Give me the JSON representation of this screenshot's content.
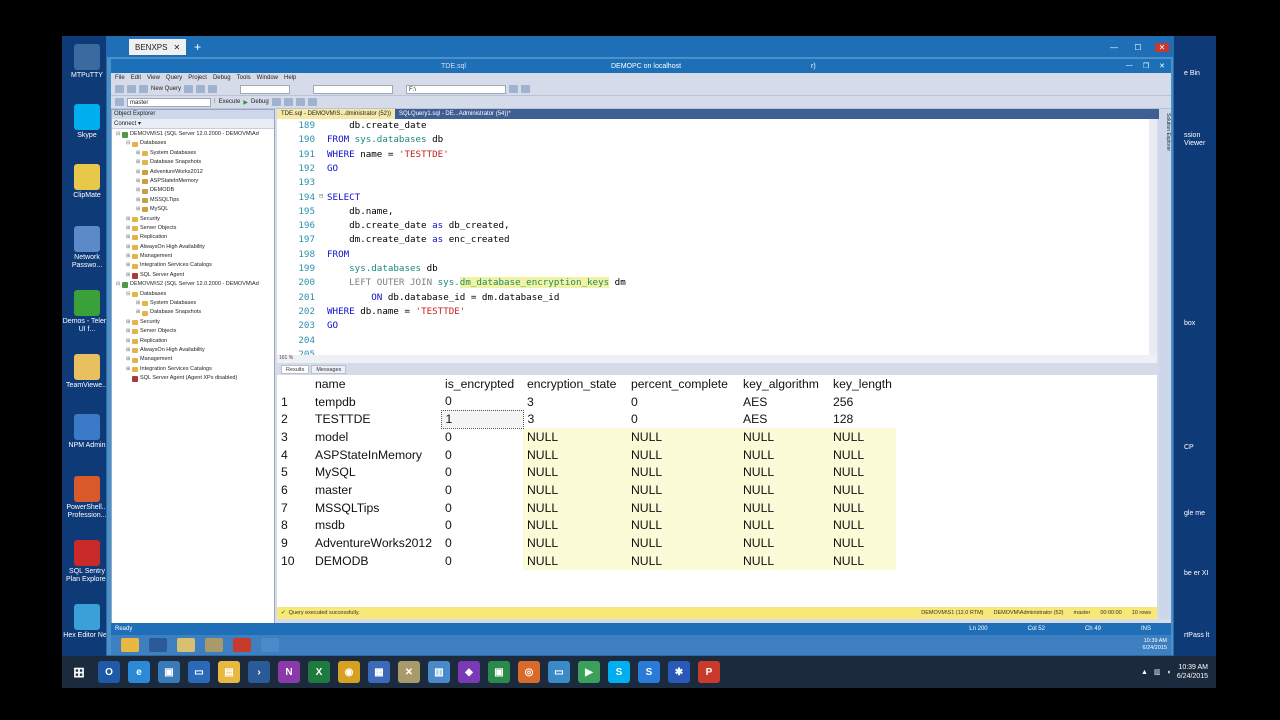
{
  "desktop": {
    "left_icons": [
      {
        "label": "MTPuTTY",
        "icon": "putty-icon",
        "color": "#3a6aa0"
      },
      {
        "label": "Skype",
        "icon": "skype-icon",
        "color": "#00aff0"
      },
      {
        "label": "ClipMate",
        "icon": "clipmate-icon",
        "color": "#e8c84a"
      },
      {
        "label": "Network Passwo...",
        "icon": "network-password-icon",
        "color": "#5a8ac8"
      },
      {
        "label": "Demos - Telerik UI f...",
        "icon": "mvc-icon",
        "color": "#3aa03a"
      },
      {
        "label": "TeamViewe...",
        "icon": "folder-icon",
        "color": "#e8c060"
      },
      {
        "label": "NPM Admin",
        "icon": "npm-admin-icon",
        "color": "#3a7ac8"
      },
      {
        "label": "PowerShell... Profession...",
        "icon": "powershell-icon",
        "color": "#d85a2a"
      },
      {
        "label": "SQL Sentry Plan Explorer",
        "icon": "sql-sentry-icon",
        "color": "#c82a2a"
      },
      {
        "label": "Hex Editor Neo",
        "icon": "hex-editor-icon",
        "color": "#3aa0d8"
      }
    ],
    "right_labels": [
      "e Bin",
      "ssion Viewer",
      "box",
      "CP",
      "gle me",
      "be er XI",
      "rtPass lt"
    ]
  },
  "rdp": {
    "tab_label": "BENXPS",
    "tab_close": "✕",
    "add_tab": "+"
  },
  "ssms": {
    "title": "DEMOPC on localhost",
    "title_file": "TDE.sql",
    "title_suffix": "r)",
    "menu": [
      "File",
      "Edit",
      "View",
      "Query",
      "Project",
      "Debug",
      "Tools",
      "Window",
      "Help"
    ],
    "toolbar": {
      "new_query": "New Query",
      "database": "master",
      "execute": "Execute",
      "debug": "Debug",
      "path": "F:\\"
    },
    "object_explorer": {
      "title": "Object Explorer",
      "connect": "Connect ▾",
      "nodes": [
        {
          "level": 0,
          "toggle": "⊟",
          "type": "server",
          "label": "DEMOVM\\S1 (SQL Server 12.0.2000 - DEMOVM\\Ad"
        },
        {
          "level": 1,
          "toggle": "⊟",
          "type": "folder",
          "label": "Databases"
        },
        {
          "level": 2,
          "toggle": "⊞",
          "type": "folder",
          "label": "System Databases"
        },
        {
          "level": 2,
          "toggle": "⊞",
          "type": "folder",
          "label": "Database Snapshots"
        },
        {
          "level": 2,
          "toggle": "⊞",
          "type": "db",
          "label": "AdventureWorks2012"
        },
        {
          "level": 2,
          "toggle": "⊞",
          "type": "db",
          "label": "ASPStateInMemory"
        },
        {
          "level": 2,
          "toggle": "⊞",
          "type": "db",
          "label": "DEMODB"
        },
        {
          "level": 2,
          "toggle": "⊞",
          "type": "db",
          "label": "MSSQLTips"
        },
        {
          "level": 2,
          "toggle": "⊞",
          "type": "db",
          "label": "MySQL"
        },
        {
          "level": 1,
          "toggle": "⊞",
          "type": "folder",
          "label": "Security"
        },
        {
          "level": 1,
          "toggle": "⊞",
          "type": "folder",
          "label": "Server Objects"
        },
        {
          "level": 1,
          "toggle": "⊞",
          "type": "folder",
          "label": "Replication"
        },
        {
          "level": 1,
          "toggle": "⊞",
          "type": "folder",
          "label": "AlwaysOn High Availability"
        },
        {
          "level": 1,
          "toggle": "⊞",
          "type": "folder",
          "label": "Management"
        },
        {
          "level": 1,
          "toggle": "⊞",
          "type": "folder",
          "label": "Integration Services Catalogs"
        },
        {
          "level": 1,
          "toggle": "⊞",
          "type": "agent",
          "label": "SQL Server Agent"
        },
        {
          "level": 0,
          "toggle": "⊟",
          "type": "server",
          "label": "DEMOVM\\S2 (SQL Server 12.0.2000 - DEMOVM\\Ad"
        },
        {
          "level": 1,
          "toggle": "⊟",
          "type": "folder",
          "label": "Databases"
        },
        {
          "level": 2,
          "toggle": "⊞",
          "type": "folder",
          "label": "System Databases"
        },
        {
          "level": 2,
          "toggle": "⊞",
          "type": "folder",
          "label": "Database Snapshots"
        },
        {
          "level": 1,
          "toggle": "⊞",
          "type": "folder",
          "label": "Security"
        },
        {
          "level": 1,
          "toggle": "⊞",
          "type": "folder",
          "label": "Server Objects"
        },
        {
          "level": 1,
          "toggle": "⊞",
          "type": "folder",
          "label": "Replication"
        },
        {
          "level": 1,
          "toggle": "⊞",
          "type": "folder",
          "label": "AlwaysOn High Availability"
        },
        {
          "level": 1,
          "toggle": "⊞",
          "type": "folder",
          "label": "Management"
        },
        {
          "level": 1,
          "toggle": "⊞",
          "type": "folder",
          "label": "Integration Services Catalogs"
        },
        {
          "level": 1,
          "toggle": "",
          "type": "agent",
          "label": "SQL Server Agent (Agent XPs disabled)"
        }
      ]
    },
    "editor_tabs": [
      {
        "label": "TDE.sql - DEMOVM\\S...dministrator (52))",
        "active": true
      },
      {
        "label": "SQLQuery1.sql - DE...Administrator (54))*",
        "active": false
      }
    ],
    "code_lines": [
      {
        "n": "189",
        "segs": [
          [
            "",
            "    db.create_date"
          ]
        ]
      },
      {
        "n": "190",
        "segs": [
          [
            "kw",
            "FROM "
          ],
          [
            "teal",
            "sys.databases"
          ],
          [
            "",
            " db"
          ]
        ]
      },
      {
        "n": "191",
        "segs": [
          [
            "kw",
            "WHERE "
          ],
          [
            "",
            "name = "
          ],
          [
            "str",
            "'TESTTDE'"
          ]
        ]
      },
      {
        "n": "192",
        "segs": [
          [
            "kw",
            "GO"
          ]
        ]
      },
      {
        "n": "193",
        "segs": [
          [
            "",
            ""
          ]
        ]
      },
      {
        "n": "194",
        "fold": "⊟",
        "segs": [
          [
            "kw",
            "SELECT"
          ]
        ]
      },
      {
        "n": "195",
        "segs": [
          [
            "",
            "    db.name,"
          ]
        ]
      },
      {
        "n": "196",
        "segs": [
          [
            "",
            "    db.create_date "
          ],
          [
            "kw",
            "as"
          ],
          [
            "",
            " db_created,"
          ]
        ]
      },
      {
        "n": "197",
        "segs": [
          [
            "",
            "    dm.create_date "
          ],
          [
            "kw",
            "as"
          ],
          [
            "",
            " enc_created"
          ]
        ]
      },
      {
        "n": "198",
        "segs": [
          [
            "kw",
            "FROM"
          ]
        ]
      },
      {
        "n": "199",
        "segs": [
          [
            "",
            "    "
          ],
          [
            "teal",
            "sys.databases"
          ],
          [
            "",
            " db"
          ]
        ]
      },
      {
        "n": "200",
        "segs": [
          [
            "gray",
            "    LEFT OUTER JOIN "
          ],
          [
            "teal",
            "sys."
          ],
          [
            "hl",
            "dm_database_encryption_keys"
          ],
          [
            "",
            " dm"
          ]
        ]
      },
      {
        "n": "201",
        "segs": [
          [
            "",
            "        "
          ],
          [
            "kw",
            "ON"
          ],
          [
            "",
            " db.database_id = dm.database_id"
          ]
        ]
      },
      {
        "n": "202",
        "segs": [
          [
            "kw",
            "WHERE "
          ],
          [
            "",
            "db.name = "
          ],
          [
            "str",
            "'TESTTDE'"
          ]
        ]
      },
      {
        "n": "203",
        "segs": [
          [
            "kw",
            "GO"
          ]
        ]
      },
      {
        "n": "204",
        "segs": [
          [
            "",
            ""
          ]
        ]
      },
      {
        "n": "205",
        "segs": [
          [
            "",
            ""
          ]
        ]
      }
    ],
    "zoom": "161 %",
    "result_tabs": [
      "Results",
      "Messages"
    ],
    "results": {
      "columns": [
        "name",
        "is_encrypted",
        "encryption_state",
        "percent_complete",
        "key_algorithm",
        "key_length"
      ],
      "rows": [
        [
          "1",
          "tempdb",
          "0",
          "3",
          "0",
          "AES",
          "256"
        ],
        [
          "2",
          "TESTTDE",
          "1",
          "3",
          "0",
          "AES",
          "128"
        ],
        [
          "3",
          "model",
          "0",
          "NULL",
          "NULL",
          "NULL",
          "NULL"
        ],
        [
          "4",
          "ASPStateInMemory",
          "0",
          "NULL",
          "NULL",
          "NULL",
          "NULL"
        ],
        [
          "5",
          "MySQL",
          "0",
          "NULL",
          "NULL",
          "NULL",
          "NULL"
        ],
        [
          "6",
          "master",
          "0",
          "NULL",
          "NULL",
          "NULL",
          "NULL"
        ],
        [
          "7",
          "MSSQLTips",
          "0",
          "NULL",
          "NULL",
          "NULL",
          "NULL"
        ],
        [
          "8",
          "msdb",
          "0",
          "NULL",
          "NULL",
          "NULL",
          "NULL"
        ],
        [
          "9",
          "AdventureWorks2012",
          "0",
          "NULL",
          "NULL",
          "NULL",
          "NULL"
        ],
        [
          "10",
          "DEMODB",
          "0",
          "NULL",
          "NULL",
          "NULL",
          "NULL"
        ]
      ]
    },
    "query_status": {
      "message": "Query executed successfully.",
      "server": "DEMOVM\\S1 (12.0 RTM)",
      "user": "DEMOVM\\Administrator (52)",
      "db": "master",
      "time": "00:00:00",
      "rows": "10 rows"
    },
    "statusbar": {
      "ready": "Ready",
      "ln": "Ln 200",
      "col": "Col 52",
      "ch": "Ch 49",
      "ins": "INS"
    },
    "solution_explorer": "Solution Explorer",
    "inner_clock": {
      "time": "10:39 AM",
      "date": "6/24/2015"
    }
  },
  "taskbar": {
    "apps": [
      {
        "icon": "outlook-icon",
        "glyph": "O",
        "color": "#1e5aa8"
      },
      {
        "icon": "ie-icon",
        "glyph": "e",
        "color": "#2a8ad8"
      },
      {
        "icon": "rdp-icon",
        "glyph": "▣",
        "color": "#3a7ab8"
      },
      {
        "icon": "monitor-icon",
        "glyph": "▭",
        "color": "#2a6ab8"
      },
      {
        "icon": "explorer-icon",
        "glyph": "▤",
        "color": "#e8b840"
      },
      {
        "icon": "powershell-icon",
        "glyph": "›",
        "color": "#2a5a98"
      },
      {
        "icon": "onenote-icon",
        "glyph": "N",
        "color": "#8a3aa8"
      },
      {
        "icon": "excel-icon",
        "glyph": "X",
        "color": "#1e7a3e"
      },
      {
        "icon": "chrome-icon",
        "glyph": "◉",
        "color": "#d8a020"
      },
      {
        "icon": "apps-icon",
        "glyph": "▦",
        "color": "#3a6ab8"
      },
      {
        "icon": "ssms-icon",
        "glyph": "✕",
        "color": "#a89a6a"
      },
      {
        "icon": "network-icon",
        "glyph": "▥",
        "color": "#4a8ac8"
      },
      {
        "icon": "visual-studio-icon",
        "glyph": "◆",
        "color": "#7a3ab8"
      },
      {
        "icon": "project-icon",
        "glyph": "▣",
        "color": "#2a8a4a"
      },
      {
        "icon": "firefox-icon",
        "glyph": "◎",
        "color": "#d86a2a"
      },
      {
        "icon": "display-icon",
        "glyph": "▭",
        "color": "#3a8ac8"
      },
      {
        "icon": "media-icon",
        "glyph": "▶",
        "color": "#3aa05a"
      },
      {
        "icon": "skype-icon",
        "glyph": "S",
        "color": "#00aff0"
      },
      {
        "icon": "skype-business-icon",
        "glyph": "S",
        "color": "#2a7ad8"
      },
      {
        "icon": "snowflake-icon",
        "glyph": "✱",
        "color": "#2a5ab8"
      },
      {
        "icon": "powerpoint-icon",
        "glyph": "P",
        "color": "#c83a2a"
      }
    ],
    "clock": {
      "time": "10:39 AM",
      "date": "6/24/2015"
    }
  }
}
